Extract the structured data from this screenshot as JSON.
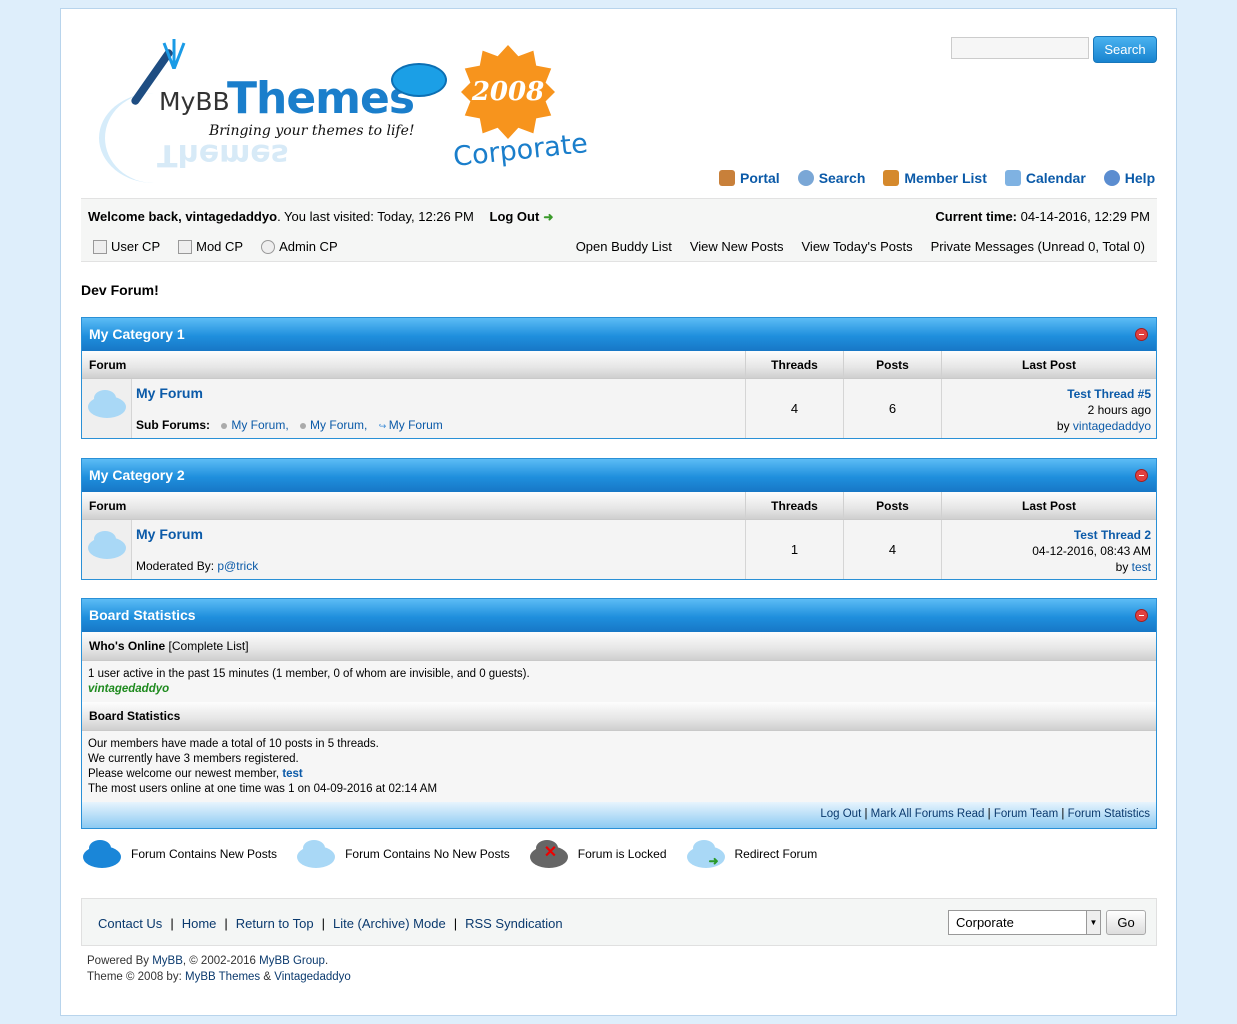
{
  "header": {
    "logo_mybb": "MyBB",
    "logo_themes": "Themes",
    "logo_tagline": "Bringing your themes to life!",
    "badge_year": "2008",
    "badge_text": "Corporate",
    "search_button": "Search",
    "search_placeholder": ""
  },
  "topnav": [
    {
      "label": "Portal",
      "icon": "house-icon",
      "color": "#c8803a"
    },
    {
      "label": "Search",
      "icon": "magnifier-icon",
      "color": "#7aa7d6"
    },
    {
      "label": "Member List",
      "icon": "members-icon",
      "color": "#d5892c"
    },
    {
      "label": "Calendar",
      "icon": "calendar-icon",
      "color": "#7fb2e2"
    },
    {
      "label": "Help",
      "icon": "help-icon",
      "color": "#5b8dd0"
    }
  ],
  "welcome": {
    "prefix": "Welcome back, ",
    "username": "vintagedaddyo",
    "last_visit": ". You last visited: Today, 12:26 PM",
    "logout": "Log Out",
    "current_time_label": "Current time:",
    "current_time": " 04-14-2016, 12:29 PM",
    "cp_links": [
      "User CP",
      "Mod CP",
      "Admin CP"
    ],
    "right_links": [
      "Open Buddy List",
      "View New Posts",
      "View Today's Posts",
      "Private Messages (Unread 0, Total 0)"
    ]
  },
  "board_message": "Dev Forum!",
  "table_headers": {
    "forum": "Forum",
    "threads": "Threads",
    "posts": "Posts",
    "last_post": "Last Post"
  },
  "categories": [
    {
      "title": "My Category 1",
      "forum": {
        "name": "My Forum",
        "sub_label": "Sub Forums:",
        "subforums": [
          "My Forum,",
          "My Forum,",
          "My Forum"
        ],
        "threads": "4",
        "posts": "6",
        "last_thread": "Test Thread #5",
        "last_time": "2 hours ago",
        "by": "by ",
        "last_user": "vintagedaddyo"
      }
    },
    {
      "title": "My Category 2",
      "forum": {
        "name": "My Forum",
        "mod_label": "Moderated By: ",
        "moderator": "p@trick",
        "threads": "1",
        "posts": "4",
        "last_thread": "Test Thread 2",
        "last_time": "04-12-2016, 08:43 AM",
        "by": "by ",
        "last_user": "test"
      }
    }
  ],
  "stats": {
    "title": "Board Statistics",
    "online_heading": "Who's Online",
    "online_link": "[Complete List]",
    "online_text": "1 user active in the past 15 minutes (1 member, 0 of whom are invisible, and 0 guests).",
    "online_user": "vintagedaddyo",
    "stats_heading": "Board Statistics",
    "line1": "Our members have made a total of 10 posts in 5 threads.",
    "line2": "We currently have 3 members registered.",
    "line3_prefix": "Please welcome our newest member, ",
    "newest_member": "test",
    "line4": "The most users online at one time was 1 on 04-09-2016 at 02:14 AM",
    "footer_links": [
      "Log Out",
      "Mark All Forums Read",
      "Forum Team",
      "Forum Statistics"
    ]
  },
  "legend": [
    "Forum Contains New Posts",
    "Forum Contains No New Posts",
    "Forum is Locked",
    "Redirect Forum"
  ],
  "footer": {
    "links": [
      "Contact Us",
      "Home",
      "Return to Top",
      "Lite (Archive) Mode",
      "RSS Syndication"
    ],
    "theme_selected": "Corporate",
    "go": "Go",
    "powered_prefix": "Powered By ",
    "powered_mybb": "MyBB",
    "powered_mid": ", © 2002-2016 ",
    "powered_group": "MyBB Group",
    "powered_end": ".",
    "theme_prefix": "Theme © 2008 by: ",
    "theme_author1": "MyBB Themes",
    "theme_amp": " & ",
    "theme_author2": "Vintagedaddyo"
  }
}
